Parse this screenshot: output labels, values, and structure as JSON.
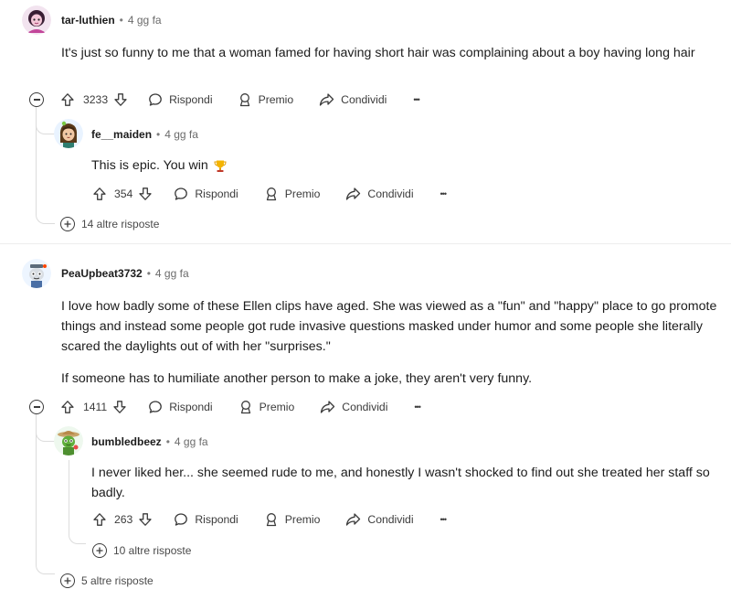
{
  "comments": [
    {
      "author": "tar-luthien",
      "time": "4 gg fa",
      "text": "It's just so funny to me that a woman famed for having short hair was complaining about a boy having long hair",
      "votes": "3233",
      "more_replies": "14 altre risposte",
      "reply": {
        "author": "fe__maiden",
        "time": "4 gg fa",
        "text": "This is epic. You win",
        "votes": "354"
      }
    },
    {
      "author": "PeaUpbeat3732",
      "time": "4 gg fa",
      "paragraphs": [
        "I love how badly some of these Ellen clips have aged. She was viewed as a \"fun\" and \"happy\" place to go promote things and instead some people got rude invasive questions masked under humor and some people she literally scared the daylights out of with her \"surprises.\"",
        "If someone has to humiliate another person to make a joke, they aren't very funny."
      ],
      "votes": "1411",
      "more_replies": "5 altre risposte",
      "reply": {
        "author": "bumbledbeez",
        "time": "4 gg fa",
        "text": "I never liked her... she seemed rude to me, and honestly I wasn't shocked to find out she treated her staff so badly.",
        "votes": "263",
        "more_replies": "10 altre risposte"
      }
    }
  ],
  "labels": {
    "reply": "Rispondi",
    "award": "Premio",
    "share": "Condividi",
    "dot": "•",
    "more": "•••"
  },
  "icons": {
    "upvote": "arrow-up-icon",
    "downvote": "arrow-down-icon",
    "reply": "speech-bubble-icon",
    "award": "award-icon",
    "share": "share-arrow-icon",
    "overflow": "ellipsis-icon",
    "collapse": "minus-circle-icon",
    "expand": "plus-circle-icon"
  }
}
